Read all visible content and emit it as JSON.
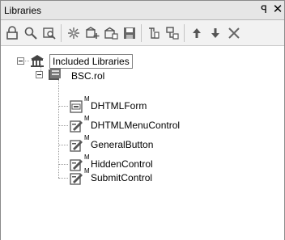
{
  "panel": {
    "title": "Libraries",
    "pin_glyph": "ꟼ",
    "close_glyph": "✕"
  },
  "toolbar": {
    "icons": [
      "lock-icon",
      "find-icon",
      "find-replace-icon",
      "new-library-icon",
      "add-library-icon",
      "library-properties-icon",
      "save-icon",
      "cut-icon",
      "copy-icon",
      "move-up-icon",
      "move-down-icon",
      "delete-icon"
    ]
  },
  "tree": {
    "root": {
      "label": "Included Libraries",
      "icon": "library-building-icon"
    },
    "library": {
      "label": "BSC.rol",
      "icon": "library-file-icon"
    },
    "items": [
      {
        "mark": "M",
        "label": "DHTMLForm",
        "icon": "form-icon"
      },
      {
        "mark": "M",
        "label": "DHTMLMenuControl",
        "icon": "control-icon"
      },
      {
        "mark": "M",
        "label": "GeneralButton",
        "icon": "control-icon"
      },
      {
        "mark": "M",
        "label": "HiddenControl",
        "icon": "control-icon"
      },
      {
        "mark": "M",
        "label": "SubmitControl",
        "icon": "control-icon"
      }
    ]
  }
}
